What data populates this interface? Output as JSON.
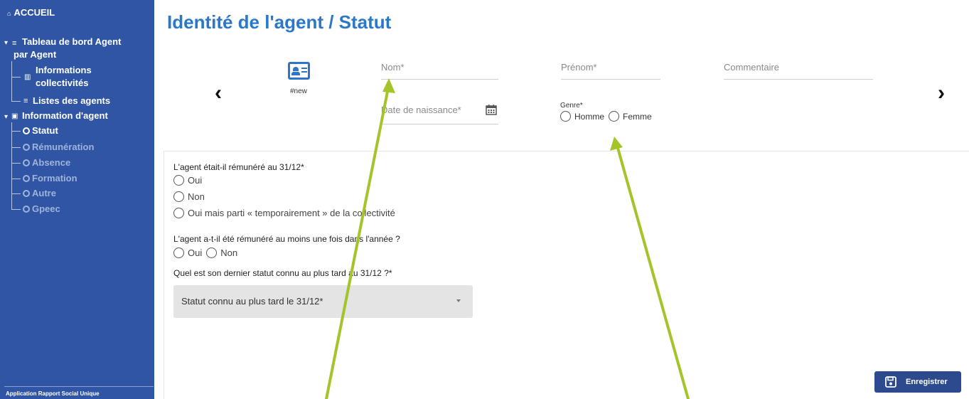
{
  "colors": {
    "sidebar_bg": "#2f55a4",
    "title_blue": "#2a78c8",
    "save_button_bg": "#2d4a8e",
    "annotation_arrow": "#a4c42a"
  },
  "sidebar": {
    "home_label": "ACCUEIL",
    "dashboard_label_line1": "Tableau de bord Agent",
    "dashboard_label_line2": "par Agent",
    "info_collectivites_line1": "Informations",
    "info_collectivites_line2": "collectivités",
    "listes_agents": "Listes des agents",
    "information_agent": "Information d'agent",
    "sections": [
      "Statut",
      "Rémunération",
      "Absence",
      "Formation",
      "Autre",
      "Gpeec"
    ],
    "footer": "Application Rapport Social Unique"
  },
  "header": {
    "title": "Identité de l'agent / Statut",
    "new_tag": "#new"
  },
  "form": {
    "nom_placeholder": "Nom*",
    "prenom_placeholder": "Prénom*",
    "commentaire_placeholder": "Commentaire",
    "date_naissance_placeholder": "Date de naissance*",
    "genre_label": "Genre*",
    "genre_options": [
      "Homme",
      "Femme"
    ]
  },
  "questions": {
    "q1": "L'agent était-il rémunéré au 31/12*",
    "q1_options": [
      "Oui",
      "Non",
      "Oui mais parti « temporairement » de la collectivité"
    ],
    "q2": "L'agent a-t-il été rémunéré au moins une fois dans l'année ?",
    "q2_options": [
      "Oui",
      "Non"
    ],
    "q3": "Quel est son dernier statut connu au plus tard au 31/12 ?*",
    "q3_select_value": "Statut connu au plus tard le 31/12*"
  },
  "actions": {
    "save_label": "Enregistrer"
  },
  "icons": {
    "prev": "chevron-left-icon",
    "next": "chevron-right-icon",
    "card": "id-card-icon",
    "calendar": "calendar-icon",
    "save": "floppy-disk-icon"
  }
}
